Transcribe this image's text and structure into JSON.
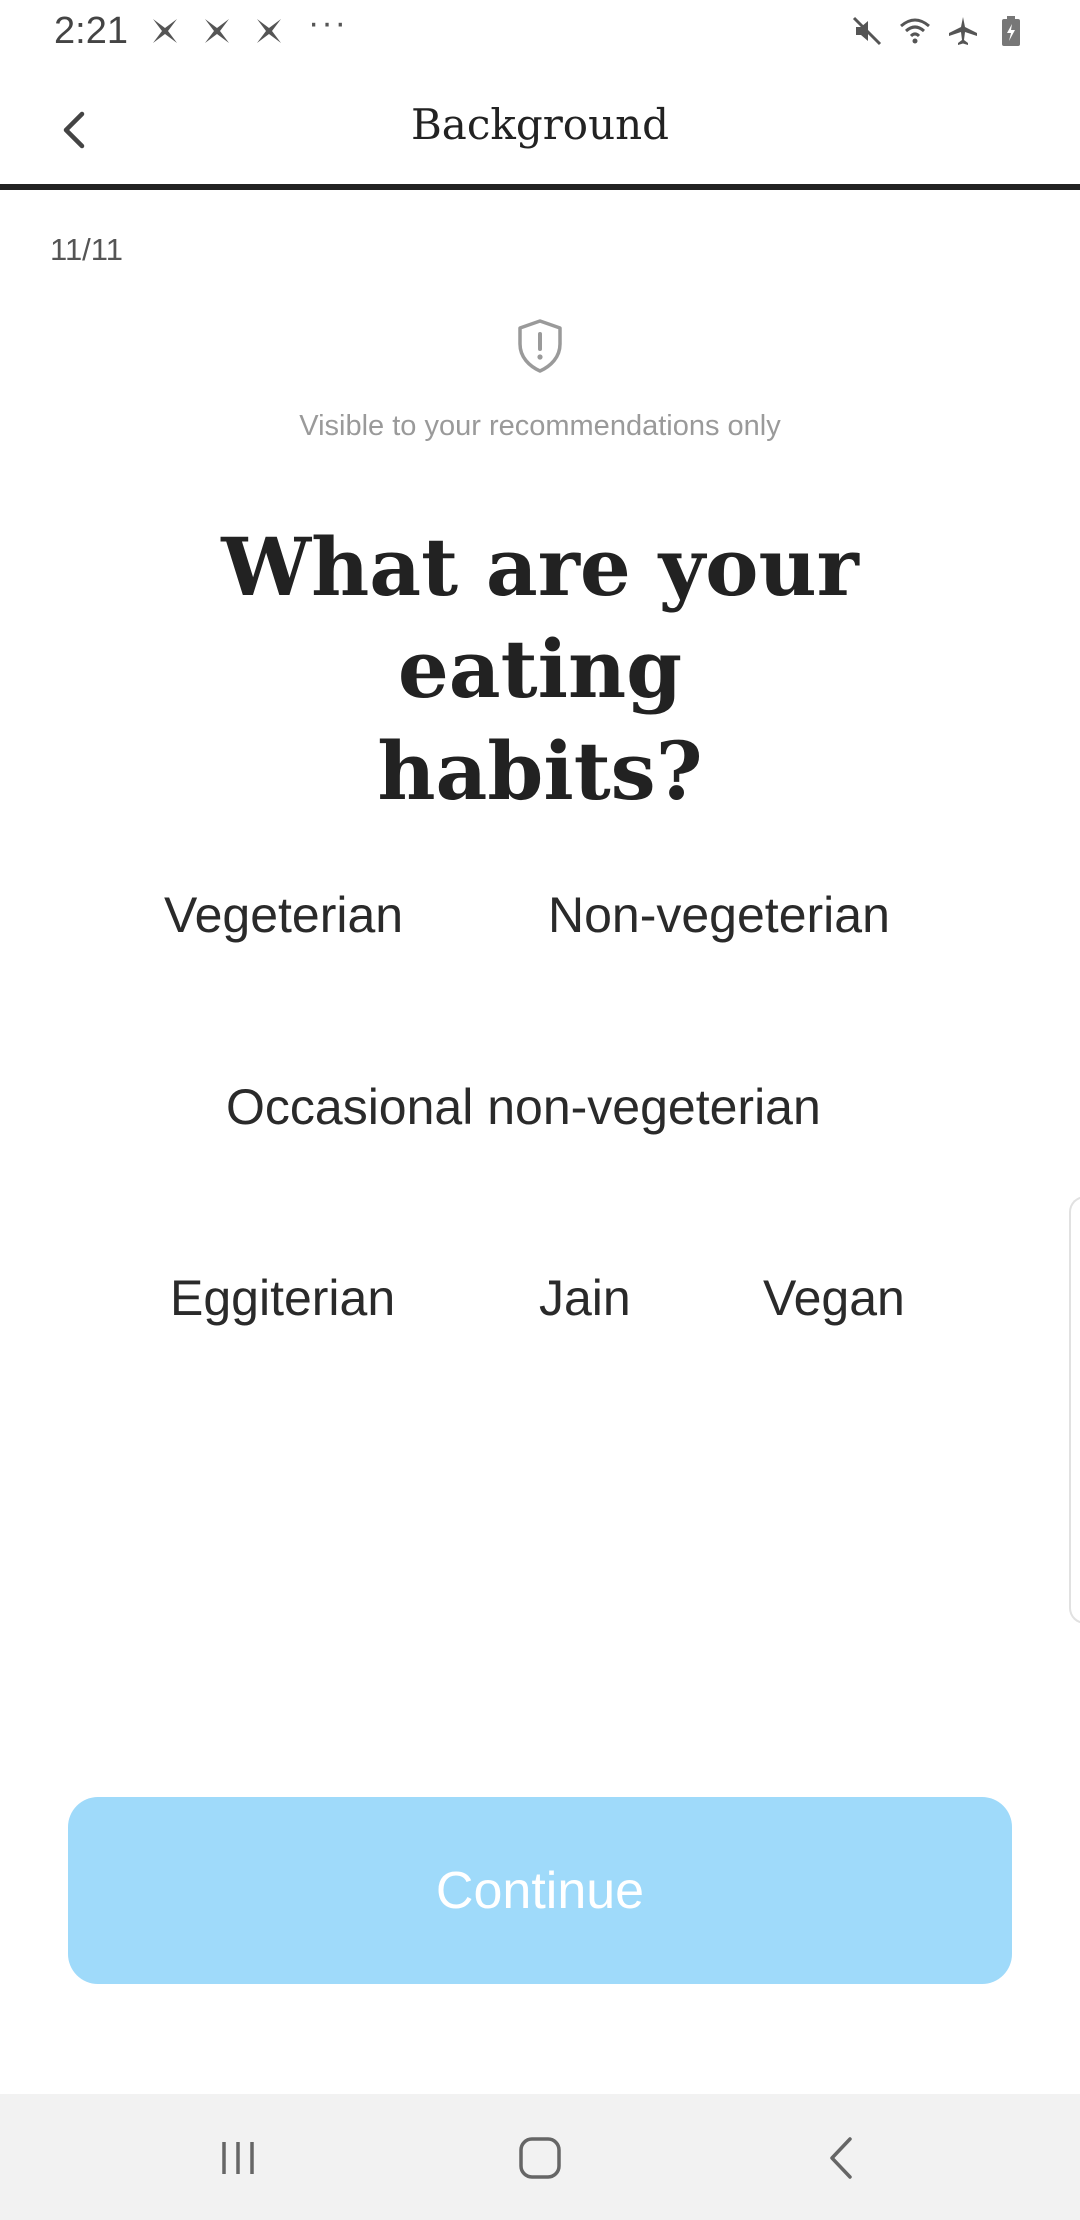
{
  "status_bar": {
    "time": "2:21",
    "more": "···",
    "left_icons": [
      "tools-cross-icon",
      "tools-cross-icon",
      "tools-cross-icon"
    ],
    "right_icons": [
      "mute-icon",
      "wifi-icon",
      "airplane-icon",
      "battery-icon"
    ]
  },
  "header": {
    "title": "Background",
    "back_icon": "chevron-left-icon",
    "progress_fraction": 1.0
  },
  "step": {
    "counter": "11/11"
  },
  "privacy": {
    "icon": "shield-alert-icon",
    "note": "Visible to your recommendations only"
  },
  "question": {
    "line1": "What are your eating",
    "line2": "habits?"
  },
  "options": [
    {
      "label": "Vegeterian"
    },
    {
      "label": "Non-vegeterian"
    },
    {
      "label": "Occasional non-vegeterian"
    },
    {
      "label": "Eggiterian"
    },
    {
      "label": "Jain"
    },
    {
      "label": "Vegan"
    }
  ],
  "continue": {
    "label": "Continue"
  },
  "colors": {
    "continue_bg": "#9fdafa",
    "progress": "#222222",
    "nav_bg": "#f2f2f2"
  },
  "nav_bar": {
    "icons": [
      "recents-icon",
      "home-icon",
      "back-icon"
    ]
  }
}
